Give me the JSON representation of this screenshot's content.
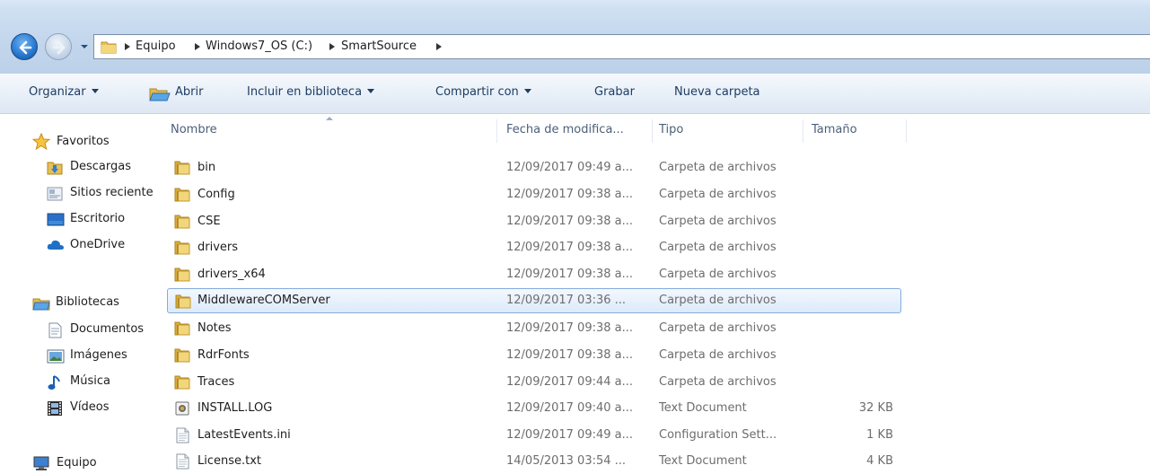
{
  "address": {
    "breadcrumbs": [
      "Equipo",
      "Windows7_OS (C:)",
      "SmartSource"
    ]
  },
  "toolbar": {
    "organize": "Organizar",
    "open": "Abrir",
    "include_library": "Incluir en biblioteca",
    "share": "Compartir con",
    "burn": "Grabar",
    "new_folder": "Nueva carpeta"
  },
  "nav": {
    "favorites": {
      "label": "Favoritos",
      "items": [
        "Descargas",
        "Sitios recientes",
        "Escritorio",
        "OneDrive"
      ]
    },
    "libraries": {
      "label": "Bibliotecas",
      "items": [
        "Documentos",
        "Imágenes",
        "Música",
        "Vídeos"
      ]
    },
    "computer": {
      "label": "Equipo"
    }
  },
  "columns": {
    "name": "Nombre",
    "date": "Fecha de modifica...",
    "type": "Tipo",
    "size": "Tamaño"
  },
  "files": [
    {
      "name": "bin",
      "date": "12/09/2017 09:49 a...",
      "type": "Carpeta de archivos",
      "size": "",
      "icon": "folder-icon"
    },
    {
      "name": "Config",
      "date": "12/09/2017 09:38 a...",
      "type": "Carpeta de archivos",
      "size": "",
      "icon": "folder-icon"
    },
    {
      "name": "CSE",
      "date": "12/09/2017 09:38 a...",
      "type": "Carpeta de archivos",
      "size": "",
      "icon": "folder-icon"
    },
    {
      "name": "drivers",
      "date": "12/09/2017 09:38 a...",
      "type": "Carpeta de archivos",
      "size": "",
      "icon": "folder-icon"
    },
    {
      "name": "drivers_x64",
      "date": "12/09/2017 09:38 a...",
      "type": "Carpeta de archivos",
      "size": "",
      "icon": "folder-icon"
    },
    {
      "name": "MiddlewareCOMServer",
      "date": "12/09/2017 03:36 ...",
      "type": "Carpeta de archivos",
      "size": "",
      "icon": "folder-icon"
    },
    {
      "name": "Notes",
      "date": "12/09/2017 09:38 a...",
      "type": "Carpeta de archivos",
      "size": "",
      "icon": "folder-icon"
    },
    {
      "name": "RdrFonts",
      "date": "12/09/2017 09:38 a...",
      "type": "Carpeta de archivos",
      "size": "",
      "icon": "folder-icon"
    },
    {
      "name": "Traces",
      "date": "12/09/2017 09:44 a...",
      "type": "Carpeta de archivos",
      "size": "",
      "icon": "folder-icon"
    },
    {
      "name": "INSTALL.LOG",
      "date": "12/09/2017 09:40 a...",
      "type": "Text Document",
      "size": "32 KB",
      "icon": "log-file-icon"
    },
    {
      "name": "LatestEvents.ini",
      "date": "12/09/2017 09:49 a...",
      "type": "Configuration Sett...",
      "size": "1 KB",
      "icon": "text-file-icon"
    },
    {
      "name": "License.txt",
      "date": "14/05/2013 03:54 ...",
      "type": "Text Document",
      "size": "4 KB",
      "icon": "text-file-icon"
    }
  ],
  "selected_file": "MiddlewareCOMServer",
  "colors": {
    "selection_border": "#84acdd",
    "toolbar_text": "#1e3d63",
    "secondary_text": "#6d6d6d"
  }
}
